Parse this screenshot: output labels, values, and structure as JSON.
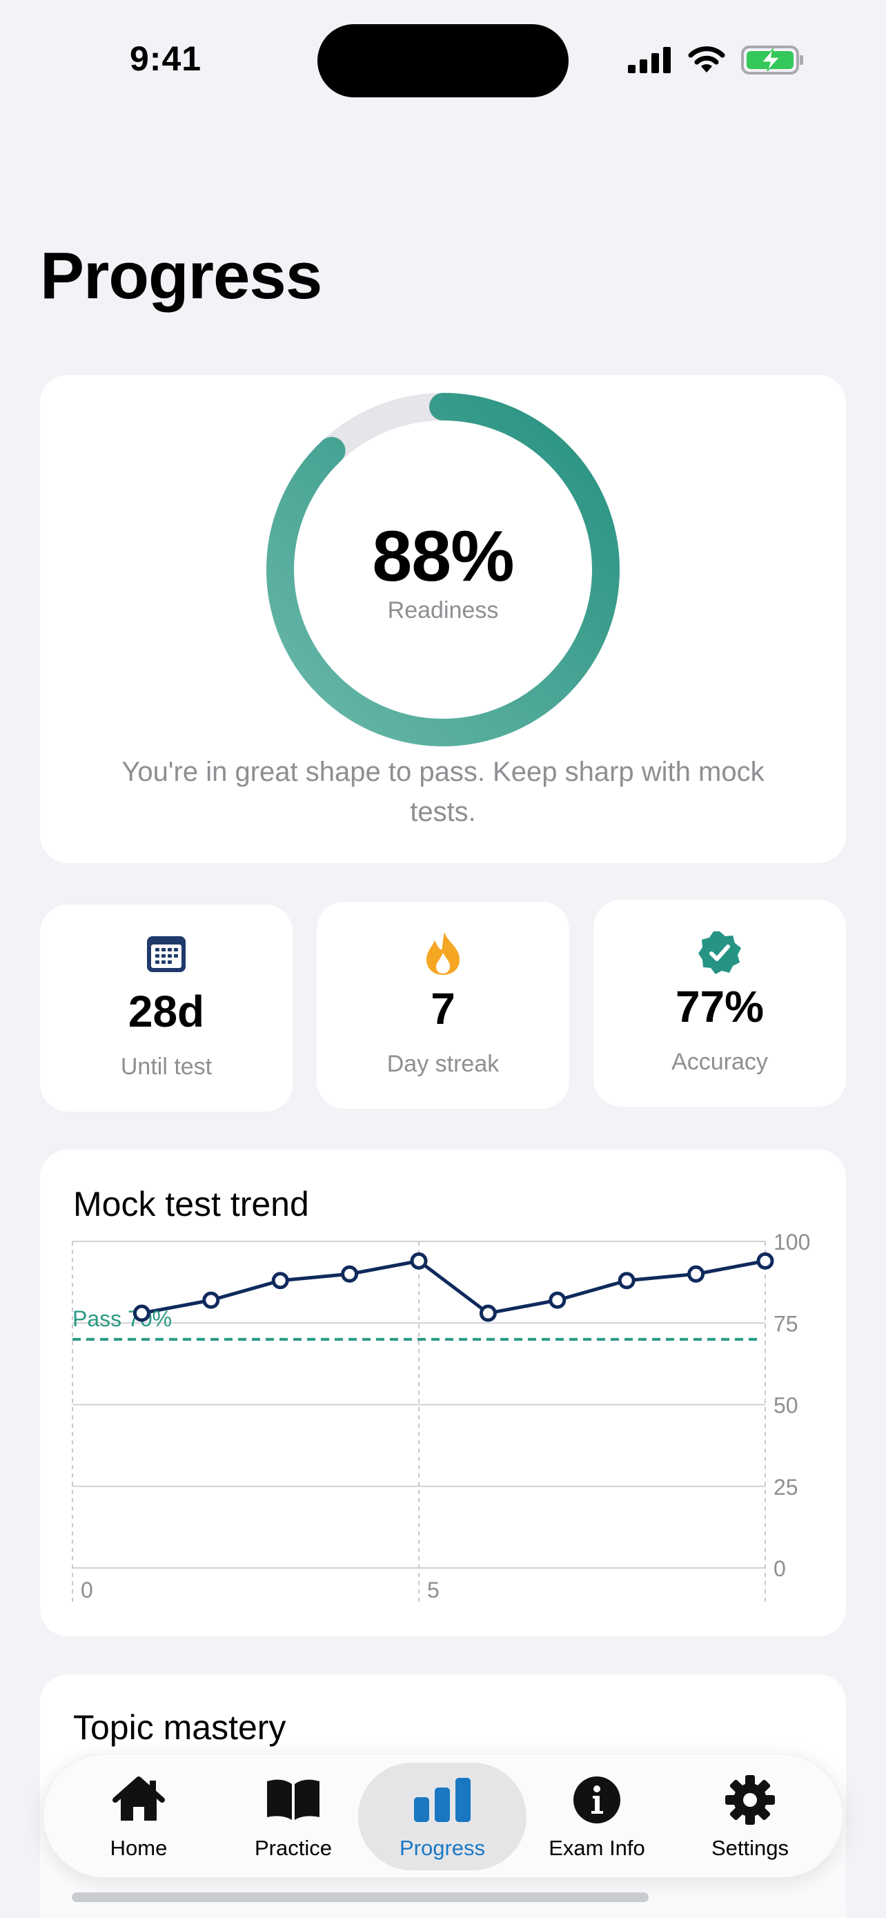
{
  "status_bar": {
    "time": "9:41"
  },
  "page": {
    "title": "Progress"
  },
  "readiness": {
    "value_text": "88%",
    "value": 88,
    "label": "Readiness",
    "message": "You're in great shape to pass. Keep sharp with mock tests."
  },
  "stats": [
    {
      "icon": "calendar-icon",
      "value": "28d",
      "label": "Until test"
    },
    {
      "icon": "flame-icon",
      "value": "7",
      "label": "Day streak"
    },
    {
      "icon": "verified-badge-icon",
      "value": "77%",
      "label": "Accuracy"
    }
  ],
  "trend": {
    "title": "Mock test trend"
  },
  "topic": {
    "title": "Topic mastery"
  },
  "tabs": [
    {
      "label": "Home",
      "icon": "house-icon"
    },
    {
      "label": "Practice",
      "icon": "book-icon"
    },
    {
      "label": "Progress",
      "icon": "bar-chart-icon"
    },
    {
      "label": "Exam Info",
      "icon": "info-icon"
    },
    {
      "label": "Settings",
      "icon": "gear-icon"
    }
  ],
  "colors": {
    "accent": "#2A9A85",
    "line": "#0F2A5C",
    "active_tab": "#1A78C2",
    "flame": "#F5A623",
    "calendar": "#1F3A6A"
  },
  "chart_data": {
    "type": "line",
    "title": "Mock test trend",
    "x": [
      1,
      2,
      3,
      4,
      5,
      6,
      7,
      8,
      9,
      10
    ],
    "series": [
      {
        "values": [
          78,
          82,
          88,
          90,
          94,
          78,
          82,
          88,
          90,
          94
        ]
      }
    ],
    "xlim": [
      0,
      10
    ],
    "ylim": [
      0,
      100
    ],
    "x_ticks": [
      0,
      5
    ],
    "y_ticks": [
      100,
      75,
      50,
      25,
      0
    ],
    "reference_line": {
      "value": 70,
      "label": "Pass 70%"
    },
    "grid": true
  }
}
